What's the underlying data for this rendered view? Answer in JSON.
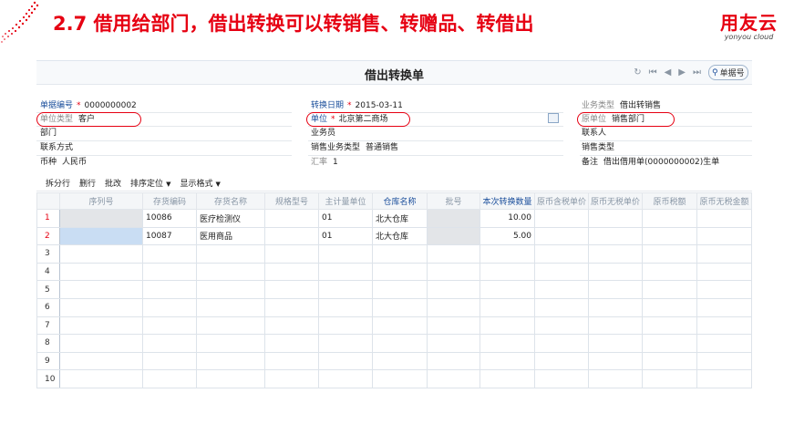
{
  "slide": {
    "title": "2.7 借用给部门，借出转换可以转销售、转赠品、转借出",
    "logo_cn": "用友云",
    "logo_en": "yonyou cloud"
  },
  "window": {
    "title": "借出转换单",
    "search_placeholder": "单据号"
  },
  "form": {
    "doc_no_label": "单据编号",
    "doc_no_value": "0000000002",
    "convert_date_label": "转换日期",
    "convert_date_value": "2015-03-11",
    "biz_type_label": "业务类型",
    "biz_type_value": "借出转销售",
    "unit_type_label": "单位类型",
    "unit_type_value": "客户",
    "unit_label": "单位",
    "unit_value": "北京第二商场",
    "orig_unit_label": "原单位",
    "orig_unit_value": "销售部门",
    "dept_label": "部门",
    "salesman_label": "业务员",
    "contact_label": "联系人",
    "contact_method_label": "联系方式",
    "sales_biz_type_label": "销售业务类型",
    "sales_biz_type_value": "普通销售",
    "sales_type_label": "销售类型",
    "currency_label": "币种",
    "currency_value": "人民币",
    "rate_label": "汇率",
    "rate_value": "1",
    "remark_label": "备注",
    "remark_value": "借出借用单(0000000002)生单"
  },
  "toolbar": {
    "split": "拆分行",
    "delete": "删行",
    "batch": "批改",
    "sort": "排序定位",
    "display": "显示格式"
  },
  "table": {
    "headers": [
      "序列号",
      "存货编码",
      "存货名称",
      "规格型号",
      "主计量单位",
      "仓库名称",
      "批号",
      "本次转换数量",
      "原币含税单价",
      "原币无税单价",
      "原币税额",
      "原币无税金额"
    ],
    "rows": [
      {
        "n": "1",
        "cells": [
          "",
          "10086",
          "医疗检测仪",
          "",
          "01",
          "北大仓库",
          "",
          "10.00",
          "",
          "",
          "",
          ""
        ]
      },
      {
        "n": "2",
        "cells": [
          "",
          "10087",
          "医用商品",
          "",
          "01",
          "北大仓库",
          "",
          "5.00",
          "",
          "",
          "",
          ""
        ]
      },
      {
        "n": "3",
        "cells": [
          "",
          "",
          "",
          "",
          "",
          "",
          "",
          "",
          "",
          "",
          "",
          ""
        ]
      },
      {
        "n": "4",
        "cells": [
          "",
          "",
          "",
          "",
          "",
          "",
          "",
          "",
          "",
          "",
          "",
          ""
        ]
      },
      {
        "n": "5",
        "cells": [
          "",
          "",
          "",
          "",
          "",
          "",
          "",
          "",
          "",
          "",
          "",
          ""
        ]
      },
      {
        "n": "6",
        "cells": [
          "",
          "",
          "",
          "",
          "",
          "",
          "",
          "",
          "",
          "",
          "",
          ""
        ]
      },
      {
        "n": "7",
        "cells": [
          "",
          "",
          "",
          "",
          "",
          "",
          "",
          "",
          "",
          "",
          "",
          ""
        ]
      },
      {
        "n": "8",
        "cells": [
          "",
          "",
          "",
          "",
          "",
          "",
          "",
          "",
          "",
          "",
          "",
          ""
        ]
      },
      {
        "n": "9",
        "cells": [
          "",
          "",
          "",
          "",
          "",
          "",
          "",
          "",
          "",
          "",
          "",
          ""
        ]
      },
      {
        "n": "10",
        "cells": [
          "",
          "",
          "",
          "",
          "",
          "",
          "",
          "",
          "",
          "",
          "",
          ""
        ]
      }
    ]
  }
}
